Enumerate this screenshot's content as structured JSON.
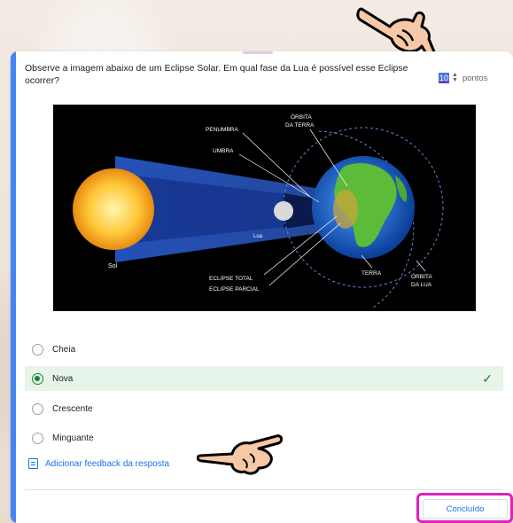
{
  "question": {
    "text": "Observe a imagem abaixo de um Eclipse Solar. Em qual fase da Lua é possível esse Eclipse ocorrer?",
    "points_value": "10",
    "points_label": "pontos"
  },
  "image_labels": {
    "penumbra": "PENUMBRA",
    "umbra": "UMBRA",
    "orbit_earth": "ÓRBITA\nDA TERRA",
    "lua": "Lua",
    "sol": "Sol",
    "eclipse_total": "ECLIPSE TOTAL",
    "eclipse_parcial": "ECLIPSE PARCIAL",
    "terra": "TERRA",
    "orbit_moon": "ÓRBITA\nDA LUA"
  },
  "options": [
    {
      "label": "Cheia",
      "selected": false
    },
    {
      "label": "Nova",
      "selected": true
    },
    {
      "label": "Crescente",
      "selected": false
    },
    {
      "label": "Minguante",
      "selected": false
    }
  ],
  "feedback_label": "Adicionar feedback da resposta",
  "done_label": "Concluído",
  "colors": {
    "accent": "#1a73e8",
    "correct_bg": "#e6f4ea",
    "correct": "#188038",
    "highlight": "#e020c0"
  }
}
